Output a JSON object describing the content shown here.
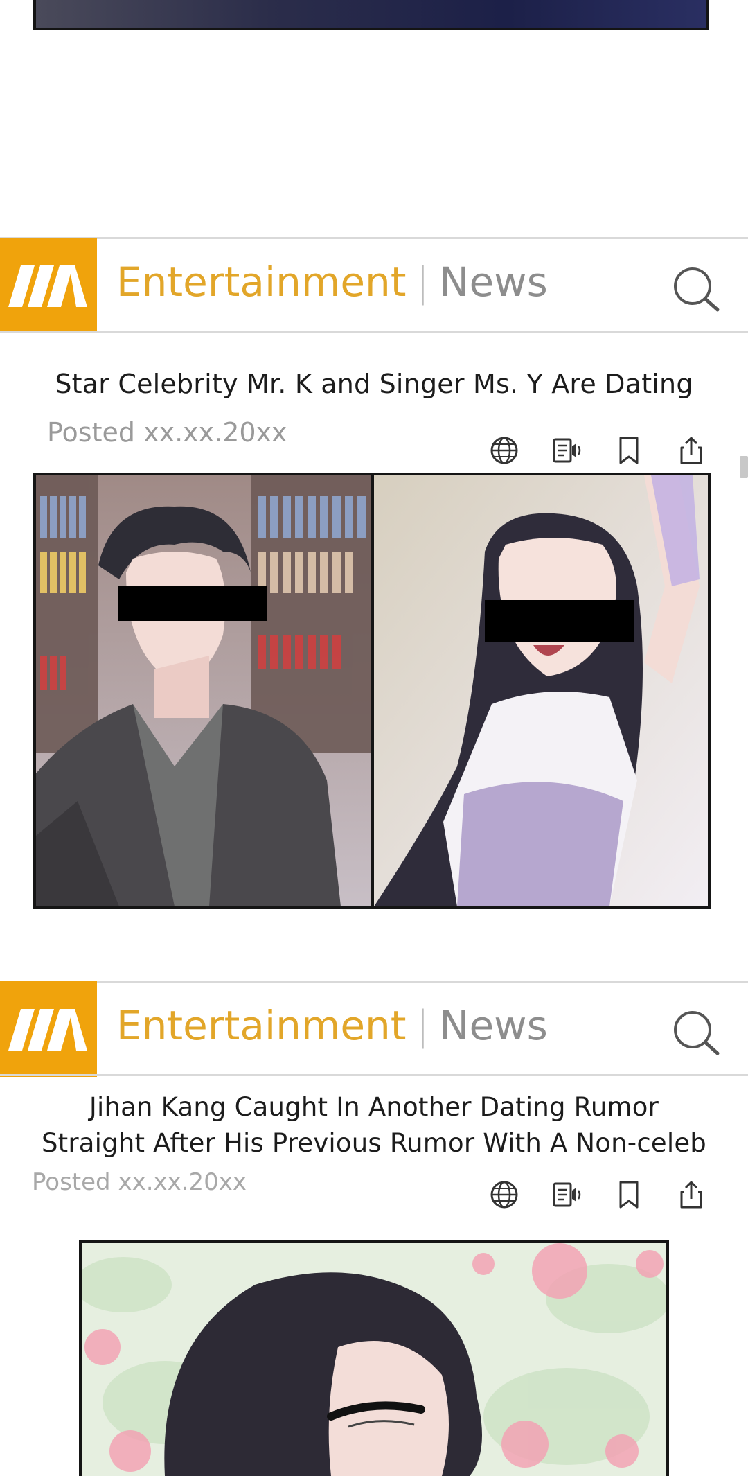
{
  "articles": [
    {
      "header": {
        "category": "Entertainment",
        "separator": "|",
        "section": "News"
      },
      "headline": "Star Celebrity Mr. K and Singer Ms. Y Are Dating",
      "posted": "Posted xx.xx.20xx",
      "actions": [
        "globe-icon",
        "text-to-speech-icon",
        "bookmark-icon",
        "share-icon"
      ]
    },
    {
      "header": {
        "category": "Entertainment",
        "separator": "|",
        "section": "News"
      },
      "headline_line1": "Jihan Kang Caught In Another Dating Rumor",
      "headline_line2": "Straight After His Previous Rumor With A Non-celeb",
      "posted": "Posted xx.xx.20xx",
      "actions": [
        "globe-icon",
        "text-to-speech-icon",
        "bookmark-icon",
        "share-icon"
      ]
    }
  ],
  "colors": {
    "brand": "#f0a30c",
    "category_text": "#e2a629",
    "section_text": "#8d8d8d",
    "divider": "#d9d9d9"
  }
}
